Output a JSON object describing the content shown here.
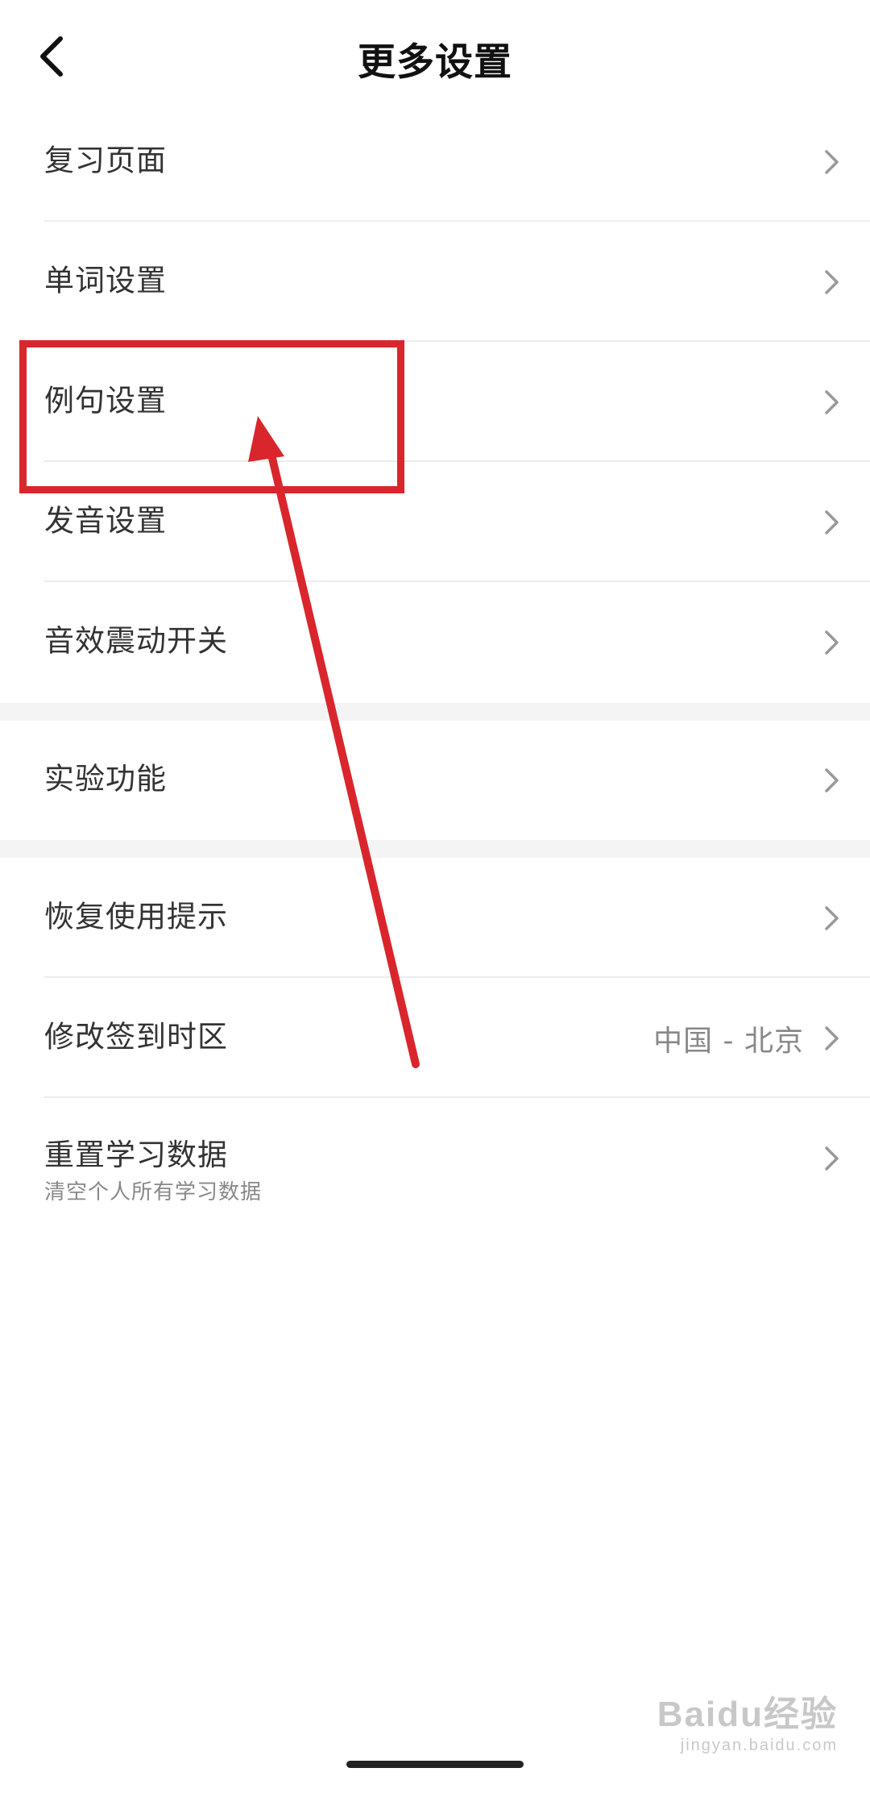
{
  "header": {
    "title": "更多设置",
    "back_icon": "chevron-left-icon"
  },
  "group1": {
    "items": [
      {
        "label": "复习页面"
      },
      {
        "label": "单词设置"
      },
      {
        "label": "例句设置"
      },
      {
        "label": "发音设置"
      },
      {
        "label": "音效震动开关"
      }
    ]
  },
  "group2": {
    "items": [
      {
        "label": "实验功能"
      }
    ]
  },
  "group3": {
    "items": [
      {
        "label": "恢复使用提示"
      },
      {
        "label": "修改签到时区",
        "value": "中国 - 北京"
      },
      {
        "label": "重置学习数据",
        "sub": "清空个人所有学习数据"
      }
    ]
  },
  "watermark": {
    "main": "Baidu经验",
    "sub": "jingyan.baidu.com"
  },
  "colors": {
    "annotation": "#d9262c",
    "label": "#333333",
    "secondary": "#888888",
    "divider": "#ececec",
    "group_gap": "#f4f4f4"
  }
}
